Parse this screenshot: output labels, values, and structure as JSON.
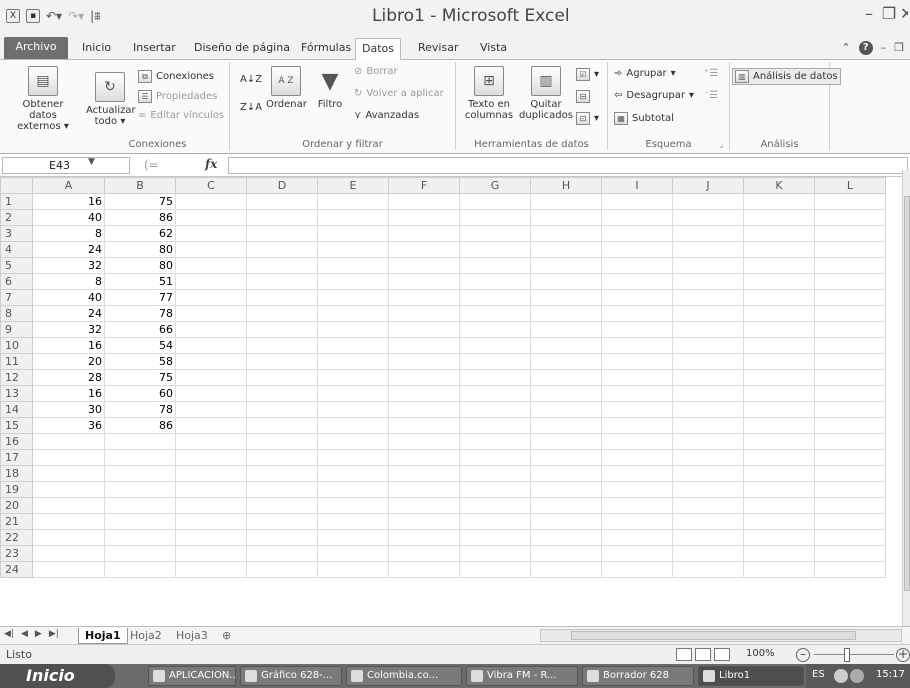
{
  "window": {
    "title": "Libro1 - Microsoft Excel"
  },
  "tabs": [
    "Archivo",
    "Inicio",
    "Insertar",
    "Diseño de página",
    "Fórmulas",
    "Datos",
    "Revisar",
    "Vista"
  ],
  "active_tab": "Datos",
  "ribbon": {
    "get_external": "Obtener datos externos",
    "refresh_all": "Actualizar todo",
    "connections": "Conexiones",
    "properties": "Propiedades",
    "edit_links": "Editar vínculos",
    "group_connections": "Conexiones",
    "sort_az": "A Z",
    "sort": "Ordenar",
    "filter": "Filtro",
    "clear": "Borrar",
    "reapply": "Volver a aplicar",
    "advanced": "Avanzadas",
    "group_sort_filter": "Ordenar y filtrar",
    "text_to_columns": "Texto en columnas",
    "remove_duplicates": "Quitar duplicados",
    "group_data_tools": "Herramientas de datos",
    "group": "Agrupar",
    "ungroup": "Desagrupar",
    "subtotal": "Subtotal",
    "group_outline": "Esquema",
    "data_analysis": "Análisis de datos",
    "group_analysis": "Análisis"
  },
  "formula_bar": {
    "name_box": "E43",
    "fx": "fx",
    "formula": ""
  },
  "columns": [
    "A",
    "B",
    "C",
    "D",
    "E",
    "F",
    "G",
    "H",
    "I",
    "J",
    "K",
    "L"
  ],
  "rows": [
    [
      "16",
      "75"
    ],
    [
      "40",
      "86"
    ],
    [
      "8",
      "62"
    ],
    [
      "24",
      "80"
    ],
    [
      "32",
      "80"
    ],
    [
      "8",
      "51"
    ],
    [
      "40",
      "77"
    ],
    [
      "24",
      "78"
    ],
    [
      "32",
      "66"
    ],
    [
      "16",
      "54"
    ],
    [
      "20",
      "58"
    ],
    [
      "28",
      "75"
    ],
    [
      "16",
      "60"
    ],
    [
      "30",
      "78"
    ],
    [
      "36",
      "86"
    ],
    [
      "",
      ""
    ],
    [
      "",
      ""
    ],
    [
      "",
      ""
    ],
    [
      "",
      ""
    ],
    [
      "",
      ""
    ],
    [
      "",
      ""
    ],
    [
      "",
      ""
    ],
    [
      "",
      ""
    ],
    [
      "",
      ""
    ]
  ],
  "sheets": [
    "Hoja1",
    "Hoja2",
    "Hoja3"
  ],
  "status": {
    "ready": "Listo",
    "zoom": "100%"
  },
  "taskbar": {
    "start": "Inicio",
    "items": [
      "APLICACION...",
      "Gráfico 628-...",
      "Colombia.co...",
      "Vibra FM - R...",
      "Borrador 628",
      "Libro1"
    ],
    "lang": "ES",
    "time": "15:17"
  }
}
